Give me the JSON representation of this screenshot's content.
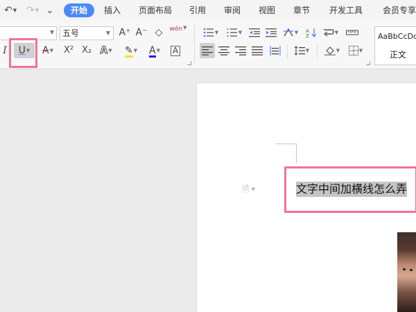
{
  "quick_access": {
    "undo": "↶",
    "redo": "↷",
    "more": "⌄"
  },
  "tabs": [
    {
      "label": "开始",
      "active": true
    },
    {
      "label": "插入"
    },
    {
      "label": "页面布局"
    },
    {
      "label": "引用"
    },
    {
      "label": "审阅"
    },
    {
      "label": "视图"
    },
    {
      "label": "章节"
    },
    {
      "label": "开发工具"
    },
    {
      "label": "会员专享"
    }
  ],
  "font": {
    "size_value": "五号"
  },
  "ribbon_icons": {
    "grow_font": "A⁺",
    "shrink_font": "A⁻",
    "clear_format": "◇",
    "phonetic": "wén",
    "italic": "I",
    "underline": "U",
    "strikethrough": "A",
    "superscript": "X²",
    "subscript": "X₂",
    "text_effect": "A",
    "highlight": "✎",
    "font_color": "A",
    "char_border": "A"
  },
  "styles": {
    "sample": "AaBbCcDd",
    "normal_label": "正文"
  },
  "document": {
    "selected_text": "文字中间加横线怎么弄"
  },
  "colors": {
    "accent": "#4b89f6",
    "highlight_box": "#f07297",
    "selection": "#c4c4c4",
    "font_color_bar": "#1a1aff",
    "highlight_bar": "#f5e31a",
    "strike_red": "#e23b3b"
  }
}
